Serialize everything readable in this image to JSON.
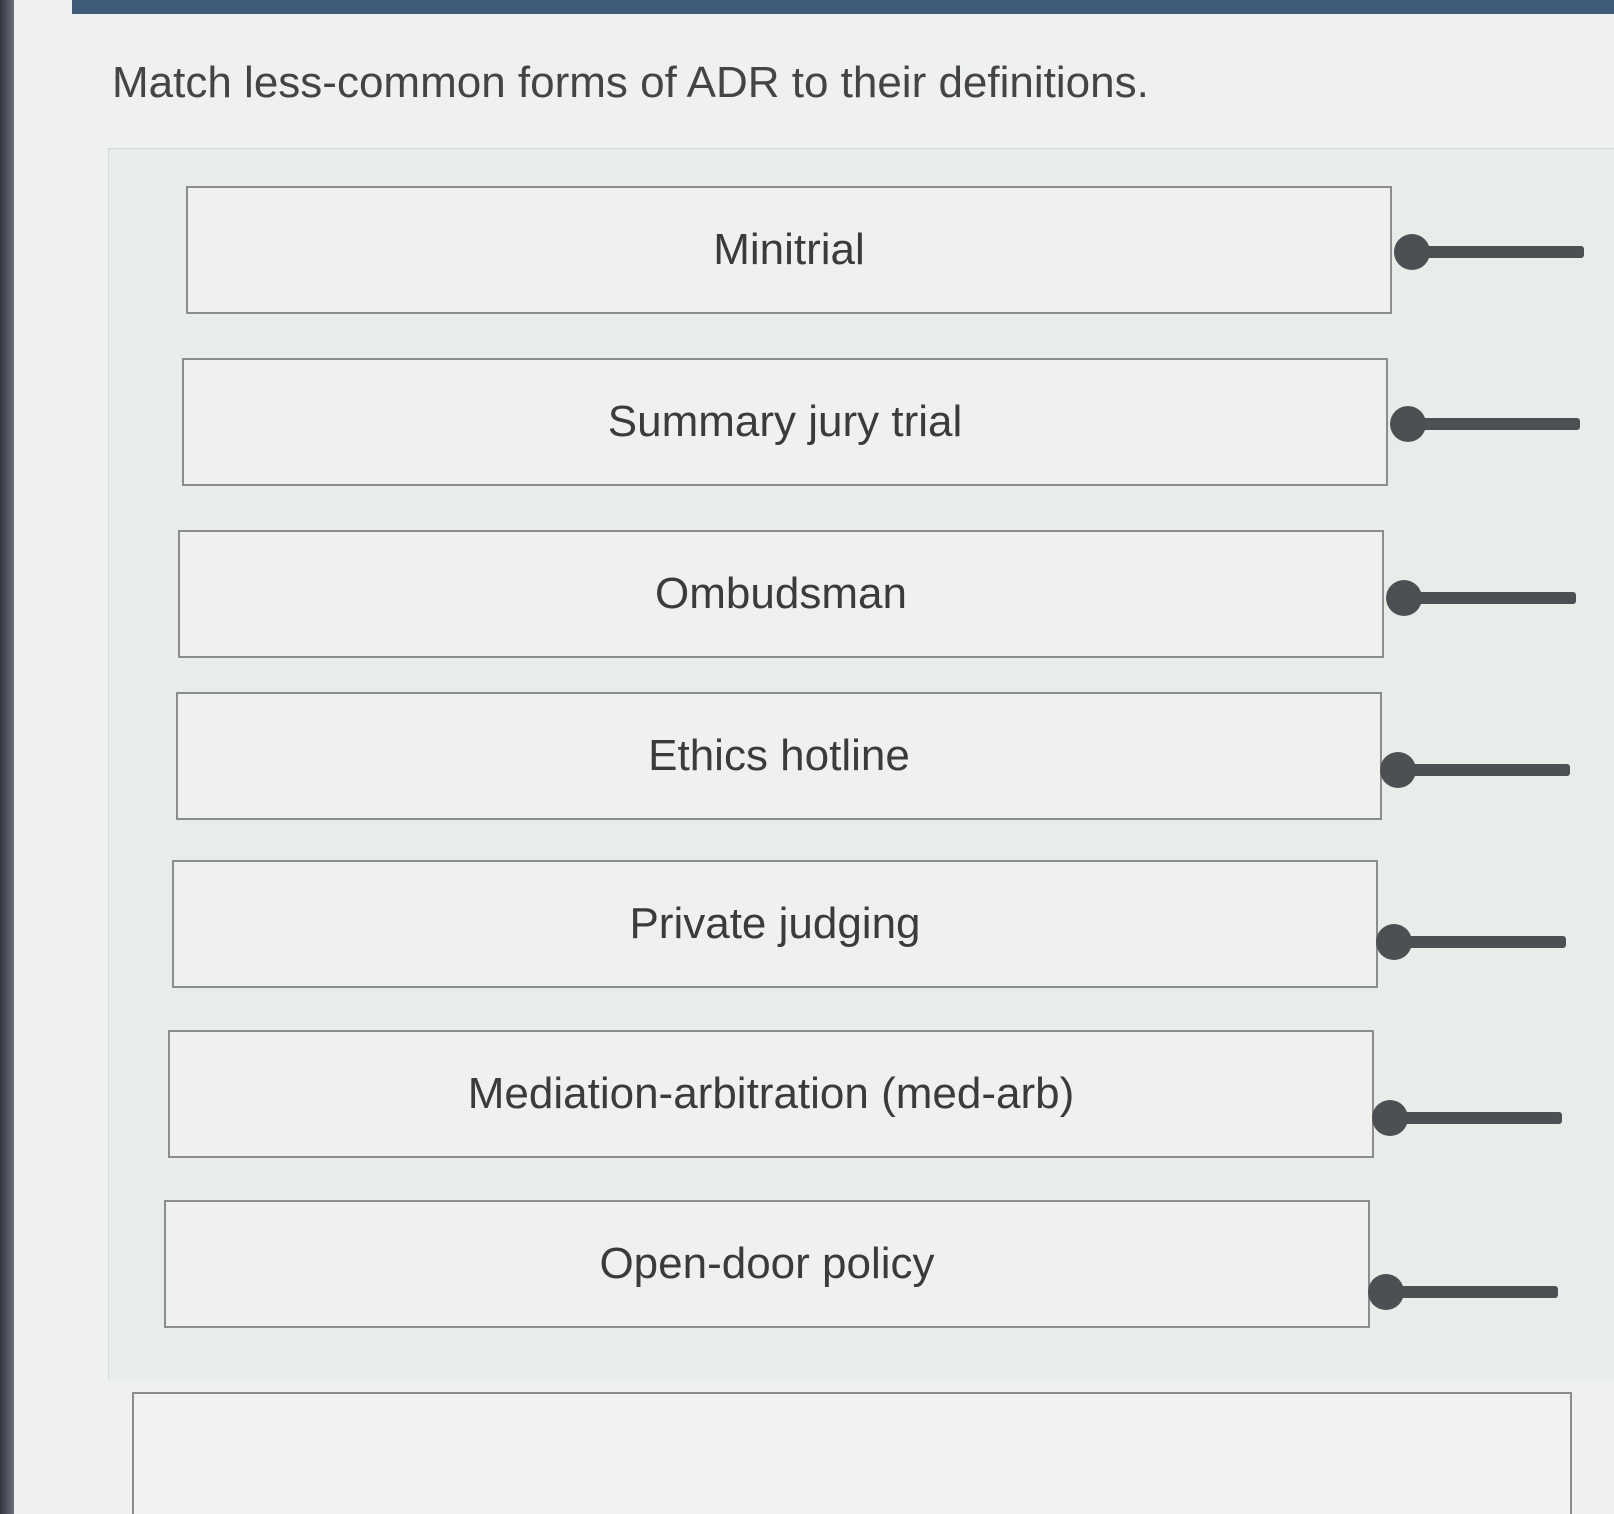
{
  "question": {
    "instruction": "Match less-common forms of ADR to their definitions."
  },
  "items": [
    {
      "label": "Minitrial"
    },
    {
      "label": "Summary jury trial"
    },
    {
      "label": "Ombudsman"
    },
    {
      "label": "Ethics hotline"
    },
    {
      "label": "Private judging"
    },
    {
      "label": "Mediation-arbitration (med-arb)"
    },
    {
      "label": "Open-door policy"
    }
  ],
  "colors": {
    "top_bar": "#3f5b78",
    "handle": "#4d5052",
    "item_border": "#8a8d8a",
    "item_background": "#f0f1ef"
  },
  "icons": {
    "drag_handle": "drag-handle-icon"
  }
}
